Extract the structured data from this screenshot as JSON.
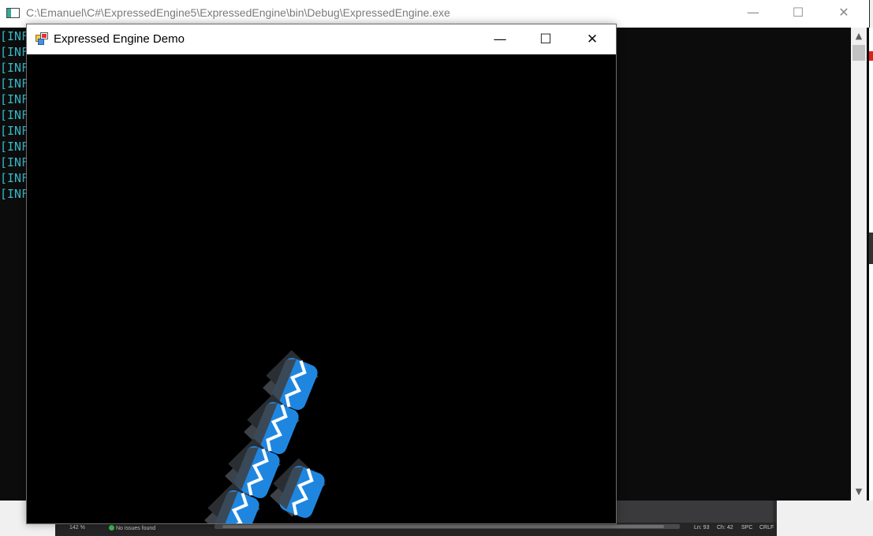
{
  "console": {
    "title": "C:\\Emanuel\\C#\\ExpressedEngine5\\ExpressedEngine\\bin\\Debug\\ExpressedEngine.exe",
    "minimize_glyph": "—",
    "maximize_glyph": "☐",
    "close_glyph": "✕",
    "lines": [
      "[INF",
      "[INF",
      "[INF",
      "[INF",
      "[INF",
      "[INF",
      "[INF",
      "[INF",
      "[INF",
      "[INF",
      "[INF"
    ],
    "text_color": "#3ab8c8",
    "scroll_up_glyph": "▲",
    "scroll_down_glyph": "▼"
  },
  "demo_window": {
    "title": "Expressed Engine Demo",
    "minimize_glyph": "—",
    "maximize_glyph": "☐",
    "close_glyph": "✕",
    "sprite_color_blue": "#1f86e0",
    "sprite_color_dark": "#3d4248"
  },
  "vs_status": {
    "zoom": "142 %",
    "issues": "No issues found",
    "line": "Ln: 93",
    "char": "Ch: 42",
    "spc": "SPC",
    "crlf": "CRLF"
  }
}
